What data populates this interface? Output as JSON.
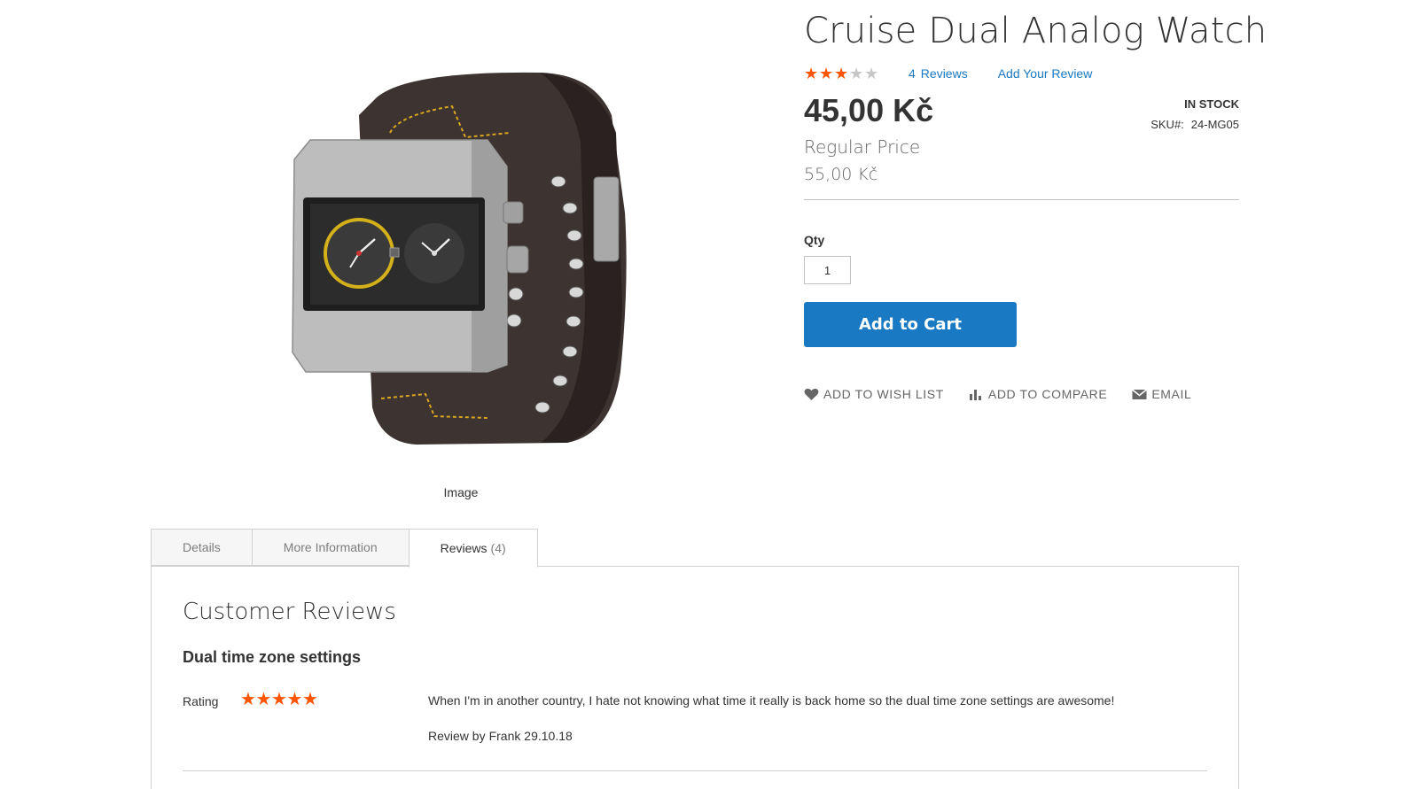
{
  "product": {
    "title": "Cruise Dual Analog Watch",
    "rating_stars": 3,
    "rating_max": 5,
    "review_count": "4",
    "reviews_label": "Reviews",
    "add_review_label": "Add Your Review",
    "price": "45,00 Kč",
    "regular_price_label": "Regular Price",
    "regular_price": "55,00 Kč",
    "stock": "IN STOCK",
    "sku_label": "SKU#:",
    "sku": "24-MG05",
    "qty_label": "Qty",
    "qty_value": "1",
    "add_to_cart": "Add to Cart",
    "image_caption": "Image",
    "star_active_color": "#ff5501",
    "star_inactive_color": "#c7c7c7"
  },
  "actions": {
    "wishlist": "ADD TO WISH LIST",
    "compare": "ADD TO COMPARE",
    "email": "EMAIL"
  },
  "tabs": {
    "details": "Details",
    "more_info": "More Information",
    "reviews": "Reviews",
    "reviews_count": "(4)"
  },
  "reviews": {
    "heading": "Customer Reviews",
    "items": [
      {
        "title": "Dual time zone settings",
        "rating_label": "Rating",
        "rating_stars": 5,
        "text": "When I'm in another country, I hate not knowing what time it really is back home so the dual time zone settings are awesome!",
        "by_label": "Review by",
        "author": "Frank",
        "date": "29.10.18"
      }
    ]
  },
  "colors": {
    "link": "#1979c3",
    "button": "#1979c3",
    "star": "#ff5501"
  }
}
